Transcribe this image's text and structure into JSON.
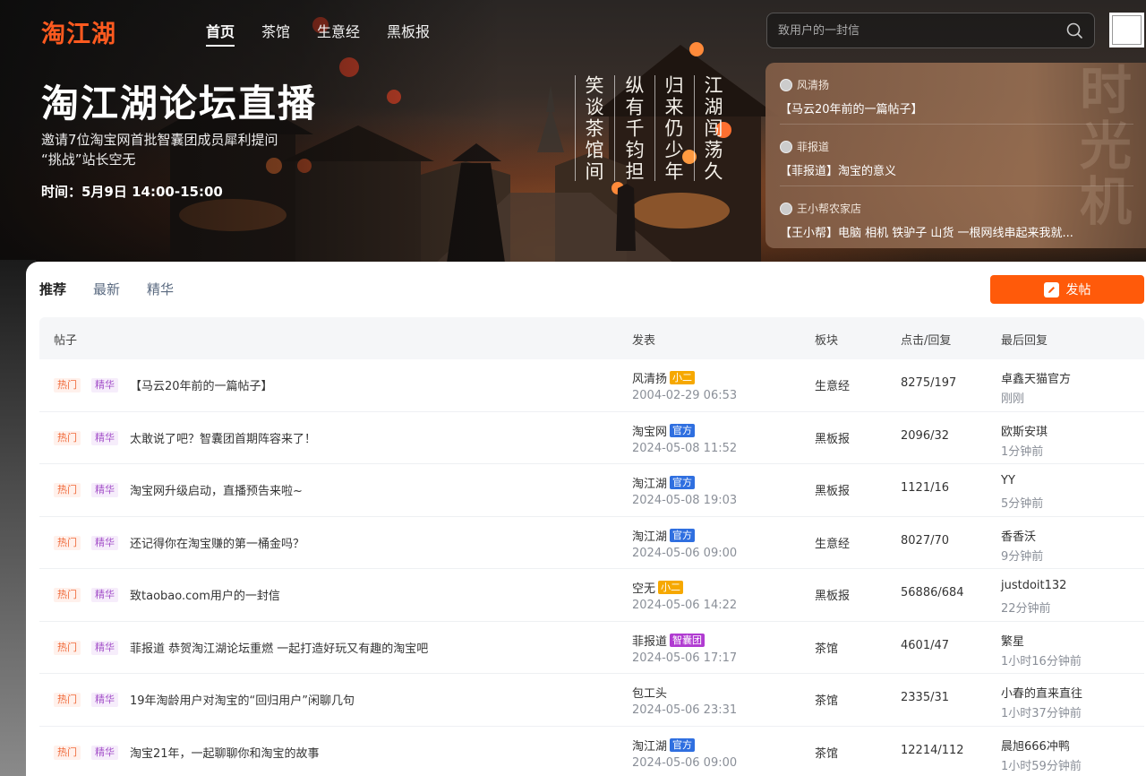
{
  "header": {
    "logo": "淘江湖",
    "nav": [
      {
        "label": "首页",
        "active": true
      },
      {
        "label": "茶馆",
        "active": false
      },
      {
        "label": "生意经",
        "active": false
      },
      {
        "label": "黑板报",
        "active": false
      }
    ],
    "search_placeholder": "致用户的一封信"
  },
  "hero": {
    "title": "淘江湖论坛直播",
    "subtitle_1": "邀请7位淘宝网首批智囊团成员犀利提问",
    "subtitle_2": "“挑战”站长空无",
    "time": "时间：5月9日 14:00-15:00",
    "poem": [
      "江湖闯荡久",
      "归来仍少年",
      "纵有千钧担",
      "笑谈茶馆间"
    ],
    "card_watermark": "时光机",
    "card_items": [
      {
        "user": "风清扬",
        "title": "【马云20年前的一篇帖子】"
      },
      {
        "user": "菲报道",
        "title": "【菲报道】淘宝的意义"
      },
      {
        "user": "王小帮农家店",
        "title": "【王小帮】电脑 相机 铁驴子 山货 一根网线串起来我就..."
      }
    ]
  },
  "tabs": [
    {
      "label": "推荐",
      "active": true
    },
    {
      "label": "最新",
      "active": false
    },
    {
      "label": "精华",
      "active": false
    }
  ],
  "post_button": "发帖",
  "table": {
    "headers": {
      "post": "帖子",
      "author": "发表",
      "board": "板块",
      "stats": "点击/回复",
      "last": "最后回复"
    },
    "tag_hot": "热门",
    "tag_best": "精华",
    "rows": [
      {
        "title": "【马云20年前的一篇帖子】",
        "author": "风清扬",
        "badge": "小二",
        "badge_color": "orange",
        "time": "2004-02-29 06:53",
        "board": "生意经",
        "stats": "8275/197",
        "last_user": "卓鑫天猫官方",
        "last_time": "刚刚"
      },
      {
        "title": "太敢说了吧？智囊团首期阵容来了！",
        "author": "淘宝网",
        "badge": "官方",
        "badge_color": "blue",
        "time": "2024-05-08 11:52",
        "board": "黑板报",
        "stats": "2096/32",
        "last_user": "欧斯安琪",
        "last_time": "1分钟前"
      },
      {
        "title": "淘宝网升级启动，直播预告来啦~",
        "author": "淘江湖",
        "badge": "官方",
        "badge_color": "blue",
        "time": "2024-05-08 19:03",
        "board": "黑板报",
        "stats": "1121/16",
        "last_user": "YY",
        "last_time": "5分钟前"
      },
      {
        "title": "还记得你在淘宝赚的第一桶金吗？",
        "author": "淘江湖",
        "badge": "官方",
        "badge_color": "blue",
        "time": "2024-05-06 09:00",
        "board": "生意经",
        "stats": "8027/70",
        "last_user": "香香沃",
        "last_time": "9分钟前"
      },
      {
        "title": "致taobao.com用户的一封信",
        "author": "空无",
        "badge": "小二",
        "badge_color": "orange",
        "time": "2024-05-06 14:22",
        "board": "黑板报",
        "stats": "56886/684",
        "last_user": "justdoit132",
        "last_time": "22分钟前"
      },
      {
        "title": "菲报道 恭贺淘江湖论坛重燃 一起打造好玩又有趣的淘宝吧",
        "author": "菲报道",
        "badge": "智囊团",
        "badge_color": "purple",
        "time": "2024-05-06 17:17",
        "board": "茶馆",
        "stats": "4601/47",
        "last_user": "繁星",
        "last_time": "1小时16分钟前"
      },
      {
        "title": "19年淘龄用户对淘宝的“回归用户”闲聊几句",
        "author": "包工头",
        "badge": "",
        "badge_color": "",
        "time": "2024-05-06 23:31",
        "board": "茶馆",
        "stats": "2335/31",
        "last_user": "小春的直来直往",
        "last_time": "1小时37分钟前"
      },
      {
        "title": "淘宝21年，一起聊聊你和淘宝的故事",
        "author": "淘江湖",
        "badge": "官方",
        "badge_color": "blue",
        "time": "2024-05-06 09:00",
        "board": "茶馆",
        "stats": "12214/112",
        "last_user": "晨旭666冲鸭",
        "last_time": "1小时59分钟前"
      }
    ]
  },
  "colors": {
    "brand": "#ff5a1f",
    "post_button": "#ff5a0a",
    "badge_orange": "#f6a800",
    "badge_blue": "#2f6fe0",
    "badge_purple": "#b03bd1"
  }
}
